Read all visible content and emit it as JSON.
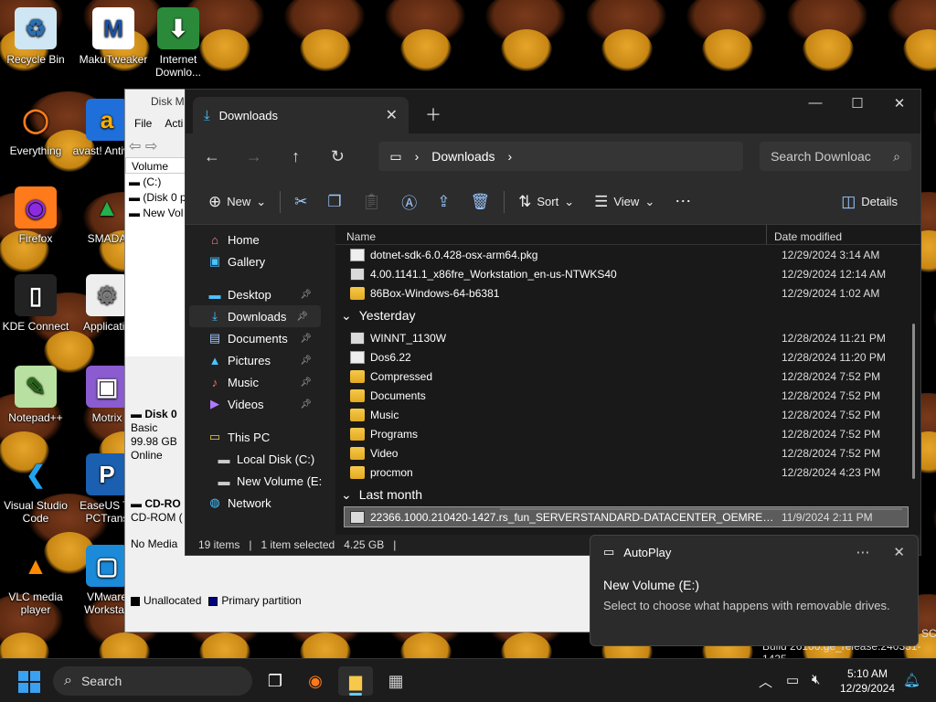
{
  "desktop": {
    "icons": [
      {
        "label": "Recycle Bin",
        "icon": "recycle-bin-icon"
      },
      {
        "label": "MakuTweaker",
        "icon": "makutweaker-icon"
      },
      {
        "label": "Internet Downlo...",
        "icon": "internet-download-icon"
      },
      {
        "label": "Everything",
        "icon": "everything-icon"
      },
      {
        "label": "avast! Antiviru",
        "icon": "avast-icon"
      },
      {
        "label": "Firefox",
        "icon": "firefox-icon"
      },
      {
        "label": "SMADA",
        "icon": "smada-icon"
      },
      {
        "label": "KDE Connect",
        "icon": "kde-connect-icon"
      },
      {
        "label": "Applicatio",
        "icon": "application-icon"
      },
      {
        "label": "Notepad++",
        "icon": "notepadpp-icon"
      },
      {
        "label": "Motrix",
        "icon": "motrix-icon"
      },
      {
        "label": "Visual Studio Code",
        "icon": "vscode-icon"
      },
      {
        "label": "EaseUS To PCTrans",
        "icon": "easeus-icon"
      },
      {
        "label": "VLC media player",
        "icon": "vlc-icon"
      },
      {
        "label": "VMware Workstati",
        "icon": "vmware-icon"
      }
    ],
    "watermark_line1": "SC",
    "watermark_line2": "Build 26100.ge_release.240331-1435"
  },
  "disk_management": {
    "title": "Disk M",
    "menu": [
      "File",
      "Acti"
    ],
    "volume_header": "Volume",
    "volumes": [
      "(C:)",
      "(Disk 0 p",
      "New Vol"
    ],
    "disk0": {
      "name": "Disk 0",
      "type": "Basic",
      "size": "99.98 GB",
      "status": "Online"
    },
    "cdrom": {
      "name": "CD-RO",
      "sub": "CD-ROM (",
      "media": "No Media"
    },
    "legend": [
      {
        "label": "Unallocated",
        "color": "#000000"
      },
      {
        "label": "Primary partition",
        "color": "#00007f"
      }
    ]
  },
  "explorer": {
    "tab_title": "Downloads",
    "address": {
      "segment": "Downloads"
    },
    "search_placeholder": "Search Downloac",
    "commands": {
      "new": "New",
      "sort": "Sort",
      "view": "View",
      "details": "Details"
    },
    "nav": [
      {
        "label": "Home",
        "icon": "home-icon",
        "pinned": false
      },
      {
        "label": "Gallery",
        "icon": "gallery-icon",
        "pinned": false
      },
      {
        "label": "Desktop",
        "icon": "desktop-icon",
        "pinned": true
      },
      {
        "label": "Downloads",
        "icon": "downloads-icon",
        "pinned": true,
        "selected": true
      },
      {
        "label": "Documents",
        "icon": "documents-icon",
        "pinned": true
      },
      {
        "label": "Pictures",
        "icon": "pictures-icon",
        "pinned": true
      },
      {
        "label": "Music",
        "icon": "music-icon",
        "pinned": true
      },
      {
        "label": "Videos",
        "icon": "videos-icon",
        "pinned": true
      },
      {
        "label": "This PC",
        "icon": "this-pc-icon",
        "pinned": false
      },
      {
        "label": "Local Disk (C:)",
        "icon": "local-disk-icon",
        "pinned": false
      },
      {
        "label": "New Volume (E:",
        "icon": "drive-icon",
        "pinned": false
      },
      {
        "label": "Network",
        "icon": "network-icon",
        "pinned": false
      }
    ],
    "columns": {
      "name": "Name",
      "date": "Date modified"
    },
    "groups": [
      {
        "label": "",
        "files": [
          {
            "name": "dotnet-sdk-6.0.428-osx-arm64.pkg",
            "date": "12/29/2024 3:14 AM",
            "type": "file"
          },
          {
            "name": "4.00.1141.1_x86fre_Workstation_en-us-NTWKS40",
            "date": "12/29/2024 12:14 AM",
            "type": "iso"
          },
          {
            "name": "86Box-Windows-64-b6381",
            "date": "12/29/2024 1:02 AM",
            "type": "folder"
          }
        ]
      },
      {
        "label": "Yesterday",
        "files": [
          {
            "name": "WINNT_1130W",
            "date": "12/28/2024 11:21 PM",
            "type": "iso"
          },
          {
            "name": "Dos6.22",
            "date": "12/28/2024 11:20 PM",
            "type": "file"
          },
          {
            "name": "Compressed",
            "date": "12/28/2024 7:52 PM",
            "type": "folder"
          },
          {
            "name": "Documents",
            "date": "12/28/2024 7:52 PM",
            "type": "folder"
          },
          {
            "name": "Music",
            "date": "12/28/2024 7:52 PM",
            "type": "folder"
          },
          {
            "name": "Programs",
            "date": "12/28/2024 7:52 PM",
            "type": "folder"
          },
          {
            "name": "Video",
            "date": "12/28/2024 7:52 PM",
            "type": "folder"
          },
          {
            "name": "procmon",
            "date": "12/28/2024 4:23 PM",
            "type": "folder"
          }
        ]
      },
      {
        "label": "Last month",
        "files": [
          {
            "name": "22366.1000.210420-1427.rs_fun_SERVERSTANDARD-DATACENTER_OEMRET_x64fr...",
            "date": "11/9/2024 2:11 PM",
            "type": "iso",
            "selected": true
          }
        ]
      }
    ],
    "status": {
      "items": "19 items",
      "selected": "1 item selected",
      "size": "4.25 GB"
    }
  },
  "autoplay": {
    "app": "AutoPlay",
    "title": "New Volume (E:)",
    "message": "Select to choose what happens with removable drives."
  },
  "taskbar": {
    "search_placeholder": "Search",
    "time": "5:10 AM",
    "date": "12/29/2024"
  }
}
